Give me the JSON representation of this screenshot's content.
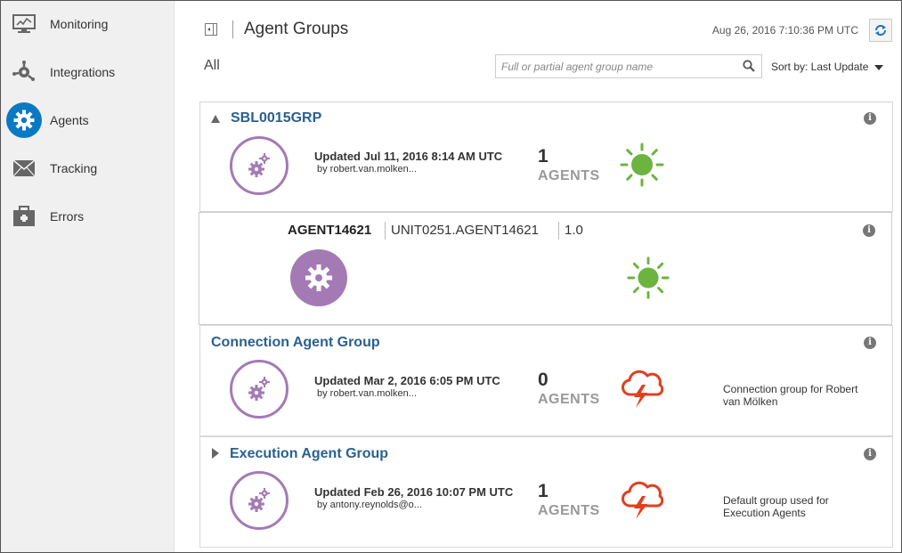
{
  "sidebar": {
    "items": [
      {
        "label": "Monitoring",
        "icon": "monitor-icon",
        "active": false
      },
      {
        "label": "Integrations",
        "icon": "integrations-icon",
        "active": false
      },
      {
        "label": "Agents",
        "icon": "gear-icon",
        "active": true
      },
      {
        "label": "Tracking",
        "icon": "envelope-icon",
        "active": false
      },
      {
        "label": "Errors",
        "icon": "briefcase-icon",
        "active": false
      }
    ]
  },
  "header": {
    "title": "Agent Groups",
    "timestamp": "Aug 26, 2016 7:10:36 PM UTC"
  },
  "filter": {
    "all_label": "All",
    "search_placeholder": "Full or partial agent group name",
    "sort_label": "Sort by: Last Update"
  },
  "groups": [
    {
      "name": "SBL0015GRP",
      "updated": "Updated Jul 11, 2016 8:14 AM UTC",
      "by": "by  robert.van.molken...",
      "count": "1",
      "agents_label": "AGENTS",
      "status": "sun-icon",
      "description": "",
      "agent": {
        "name": "AGENT14621",
        "id": "UNIT0251.AGENT14621",
        "version": "1.0",
        "status": "sun-icon"
      }
    },
    {
      "name": "Connection Agent Group",
      "updated": "Updated Mar 2, 2016 6:05 PM UTC",
      "by": "by  robert.van.molken...",
      "count": "0",
      "agents_label": "AGENTS",
      "status": "storm-cloud-icon",
      "description": "Connection group for Robert van Mölken"
    },
    {
      "name": "Execution Agent Group",
      "updated": "Updated Feb 26, 2016 10:07 PM UTC",
      "by": "by  antony.reynolds@o...",
      "count": "1",
      "agents_label": "AGENTS",
      "status": "storm-cloud-icon",
      "description": "Default group used for Execution Agents"
    }
  ],
  "colors": {
    "accent": "#0a79c4",
    "title_blue": "#2b5f8f",
    "purple": "#a47ab5",
    "green": "#6db33f",
    "storm_red": "#e1401f"
  }
}
